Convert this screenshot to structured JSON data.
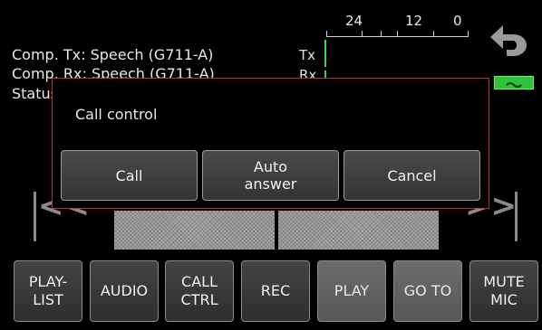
{
  "status": {
    "comp_tx": "Comp. Tx: Speech (G711-A)",
    "comp_rx": "Comp. Rx: Speech (G711-A)",
    "status_label": "Status"
  },
  "meter": {
    "tx_label": "Tx",
    "rx_label": "Rx",
    "scale": [
      "24",
      "12",
      "0"
    ]
  },
  "dialog": {
    "title": "Call control",
    "buttons": [
      "Call",
      "Auto\nanswer",
      "Cancel"
    ]
  },
  "transport": {
    "prev_symbol": "<<",
    "next_symbol": ">>"
  },
  "toolbar": [
    {
      "label": "PLAY-\nLIST",
      "active": false
    },
    {
      "label": "AUDIO",
      "active": false
    },
    {
      "label": "CALL\nCTRL",
      "active": false
    },
    {
      "label": "REC",
      "active": false
    },
    {
      "label": "PLAY",
      "active": true
    },
    {
      "label": "GO TO",
      "active": true
    },
    {
      "label": "MUTE\nMIC",
      "active": false
    }
  ],
  "colors": {
    "dialog_border": "#b83030",
    "level_green": "#2ec33a",
    "meter_green": "#3fd34a"
  }
}
